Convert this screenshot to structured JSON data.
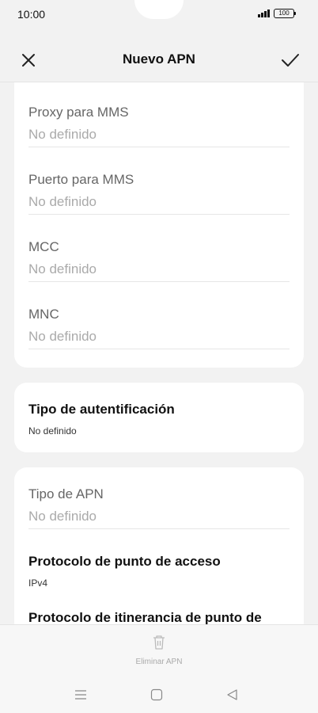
{
  "status_bar": {
    "time": "10:00",
    "battery": "100"
  },
  "header": {
    "title": "Nuevo APN",
    "close_icon": "close-icon",
    "confirm_icon": "check-icon"
  },
  "card1": {
    "fields": [
      {
        "label": "Proxy para MMS",
        "value": "No definido"
      },
      {
        "label": "Puerto para MMS",
        "value": "No definido"
      },
      {
        "label": "MCC",
        "value": "No definido"
      },
      {
        "label": "MNC",
        "value": "No definido"
      }
    ]
  },
  "card2": {
    "label": "Tipo de autentificación",
    "value": "No definido"
  },
  "card3": {
    "apn_type": {
      "label": "Tipo de APN",
      "value": "No definido"
    },
    "protocol": {
      "label": "Protocolo de punto de acceso",
      "value": "IPv4"
    },
    "roaming_protocol": {
      "label": "Protocolo de itinerancia de punto de"
    }
  },
  "bottom": {
    "delete_label": "Eliminar APN",
    "delete_icon": "trash-icon"
  },
  "nav": {
    "menu_icon": "menu-icon",
    "home_icon": "home-square-icon",
    "back_icon": "back-triangle-icon"
  }
}
